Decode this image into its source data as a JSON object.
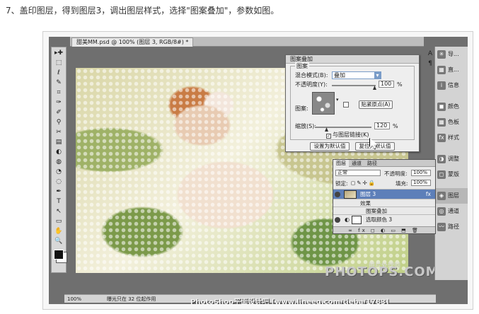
{
  "instruction": "7、盖印图层，得到图层3，调出图层样式，选择\"图案叠加\"，参数如图。",
  "document_tab": "甜美MM.psd @ 100% (图层 3, RGB/8#) *",
  "toolbar_tools": [
    "▸✚",
    "⬚",
    "ℓ",
    "✎",
    "⌗",
    "✑",
    "✐",
    "⚲",
    "✂",
    "▤",
    "◐",
    "◍",
    "◔",
    "◌",
    "✒",
    "T",
    "↖",
    "▭",
    "✋",
    "🔍"
  ],
  "status": {
    "zoom": "100%",
    "doc_info": "曝光只在 32 位起作用"
  },
  "dock_panels": [
    {
      "icon": "✳",
      "label": "导..."
    },
    {
      "icon": "▦",
      "label": "直..."
    },
    {
      "icon": "i",
      "label": "信息"
    },
    {
      "icon": "◼",
      "label": "颜色"
    },
    {
      "icon": "▦",
      "label": "色板"
    },
    {
      "icon": "fx",
      "label": "样式"
    },
    {
      "icon": "◑",
      "label": "调整"
    },
    {
      "icon": "◻",
      "label": "蒙版"
    },
    {
      "icon": "◈",
      "label": "图层"
    },
    {
      "icon": "◎",
      "label": "通道"
    },
    {
      "icon": "〰",
      "label": "路径"
    }
  ],
  "mid_icons": [
    "A",
    "¶"
  ],
  "pattern_dialog": {
    "title": "图案叠加",
    "group": "图案",
    "blend_mode_label": "混合模式(B):",
    "blend_mode": "叠加",
    "opacity_label": "不透明度(Y):",
    "opacity": "100",
    "percent": "%",
    "pattern_label": "图案:",
    "snap_button": "贴紧原点(A)",
    "scale_label": "缩放(S):",
    "scale": "120",
    "link_label": "与图层链接(K)",
    "set_default": "设置为默认值",
    "reset_default": "复位为默认值"
  },
  "layers_panel": {
    "tabs": [
      "图层",
      "通道",
      "路径"
    ],
    "blend": "正常",
    "opacity_label": "不透明度:",
    "opacity": "100%",
    "lock_label": "锁定:",
    "fill_label": "填充:",
    "fill": "100%",
    "layers": [
      "图层 3",
      "效果",
      "图案叠加",
      "选取颜色 3"
    ],
    "fx_badge": "fx"
  },
  "watermark": {
    "site": "照片处理网",
    "logo": "PHOTOPS.COM",
    "footer": "PhotoShop平面设计吧 [www.lineeg.com/tieba/1783]"
  }
}
